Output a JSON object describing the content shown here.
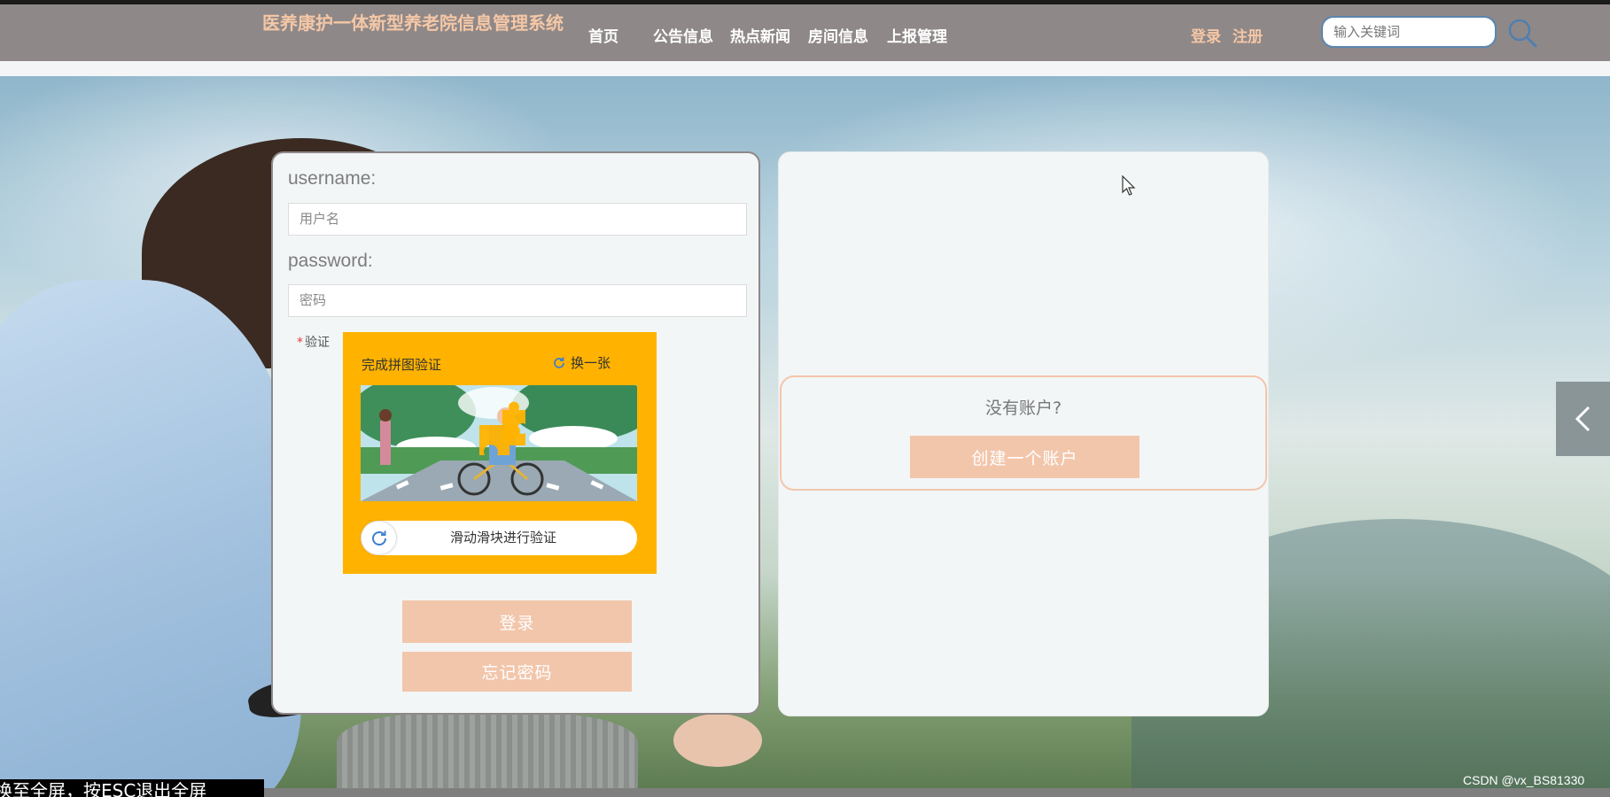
{
  "header": {
    "site_title": "医养康护一体新型养老院信息管理系统",
    "nav": [
      "首页",
      "公告信息",
      "热点新闻",
      "房间信息",
      "上报管理"
    ],
    "login_link": "登录",
    "register_link": "注册",
    "search_placeholder": "输入关键词"
  },
  "login_form": {
    "username_label": "username:",
    "username_placeholder": "用户名",
    "password_label": "password:",
    "password_placeholder": "密码",
    "verify_required_mark": "*",
    "verify_label": "验证",
    "captcha": {
      "title": "完成拼图验证",
      "refresh_label": "换一张",
      "slider_text": "滑动滑块进行验证"
    },
    "login_button": "登录",
    "forgot_button": "忘记密码"
  },
  "register_panel": {
    "no_account_text": "没有账户?",
    "create_button": "创建一个账户"
  },
  "overlay": {
    "fullscreen_hint": "换至全屏，按ESC退出全屏",
    "watermark": "CSDN @vx_BS81330"
  },
  "colors": {
    "header_bg": "#8f8888",
    "accent_peach": "#f2c6ab",
    "captcha_bg": "#ffb300",
    "panel_bg": "#f3f6f7"
  },
  "icons": {
    "search": "search-icon",
    "refresh": "refresh-icon",
    "slider": "refresh-icon",
    "toggle": "chevron-left-icon",
    "cursor": "mouse-pointer-icon"
  }
}
